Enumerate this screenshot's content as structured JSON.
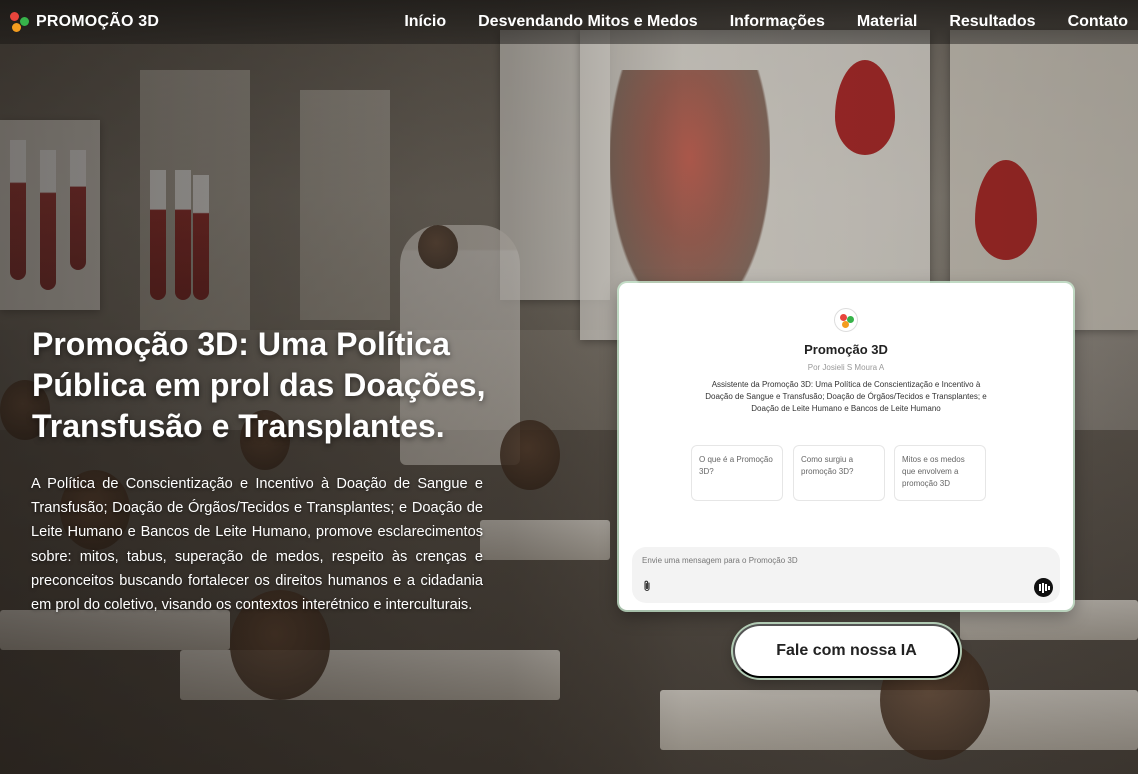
{
  "brand": {
    "name": "PROMOÇÃO 3D"
  },
  "nav": {
    "items": [
      {
        "label": "Início"
      },
      {
        "label": "Desvendando Mitos e Medos"
      },
      {
        "label": "Informações"
      },
      {
        "label": "Material"
      },
      {
        "label": "Resultados"
      },
      {
        "label": "Contato"
      }
    ]
  },
  "hero": {
    "title": "Promoção 3D: Uma Política Pública em prol das Doações, Transfusão e Transplantes.",
    "description": "A Política de Conscientização e Incentivo à Doação de Sangue e Transfusão; Doação de Órgãos/Tecidos e Transplantes; e Doação de Leite Humano e Bancos de Leite Humano, promove esclarecimentos sobre: mitos, tabus, superação de medos, respeito às crenças e preconceitos buscando fortalecer os direitos humanos e a cidadania em prol do coletivo, visando os contextos interétnico e interculturais."
  },
  "chat": {
    "name": "Promoção 3D",
    "author": "Por Josieli S Moura A",
    "subtitle": "Assistente da Promoção 3D: Uma Política de Conscientização e Incentivo à Doação de Sangue e Transfusão; Doação de Órgãos/Tecidos e Transplantes; e Doação de Leite Humano e Bancos de Leite Humano",
    "suggestions": [
      {
        "text": "O que é a Promoção 3D?"
      },
      {
        "text": "Como surgiu a promoção 3D?"
      },
      {
        "text": "Mitos e os medos que envolvem a promoção 3D"
      }
    ],
    "input_placeholder": "Envie uma mensagem para o Promoção 3D"
  },
  "cta": {
    "label": "Fale com nossa IA"
  },
  "colors": {
    "accent_glow": "#cef0d5",
    "logo_red": "#e8453c",
    "logo_green": "#37b34a",
    "logo_orange": "#f39c1f"
  }
}
